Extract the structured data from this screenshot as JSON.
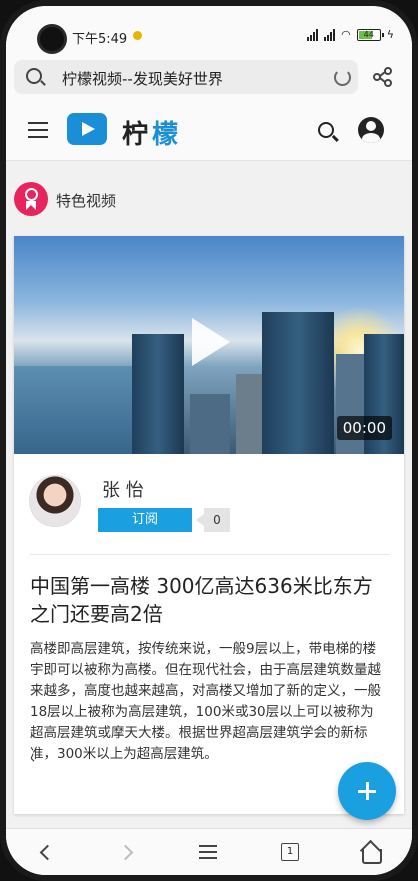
{
  "status_bar": {
    "time": "下午5:49",
    "battery": "44"
  },
  "browser": {
    "address_text": "柠檬视频--发现美好世界"
  },
  "app": {
    "brand_left": "柠",
    "brand_right": "檬"
  },
  "section": {
    "title": "特色视频"
  },
  "video": {
    "duration": "00:00"
  },
  "author": {
    "name": "张 怡",
    "subscribe_label": "订阅",
    "subscriber_count": "0"
  },
  "article": {
    "title": "中国第一高楼 300亿高达636米比东方之门还要高2倍",
    "body": "高楼即高层建筑，按传统来说，一般9层以上，带电梯的楼宇即可以被称为高楼。但在现代社会，由于高层建筑数量越来越多，高度也越来越高，对高楼又增加了新的定义，一般18层以上被称为高层建筑，100米或30层以上可以被称为超高层建筑或摩天大楼。根据世界超高层建筑学会的新标准，300米以上为超高层建筑。",
    "trailing_mark": "、"
  },
  "bottom_nav": {
    "tab_count": "1"
  },
  "colors": {
    "accent": "#1aa0e0",
    "badge": "#e8245e",
    "logo": "#1a8fd8"
  }
}
